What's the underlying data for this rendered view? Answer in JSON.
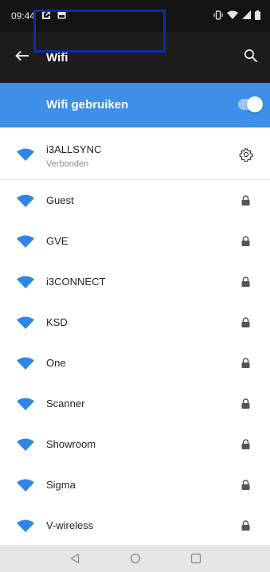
{
  "status_bar": {
    "time": "09:44",
    "left_icons": [
      "screen-record-icon",
      "gallery-icon"
    ],
    "right_icons": [
      "vibrate-icon",
      "wifi-signal-icon",
      "cell-signal-icon",
      "battery-icon"
    ]
  },
  "app_bar": {
    "title": "Wifi",
    "back_icon": "arrow-left-icon",
    "search_icon": "search-icon"
  },
  "toggle": {
    "label": "Wifi gebruiken",
    "state": "on"
  },
  "networks": [
    {
      "ssid": "i3ALLSYNC",
      "status": "Verbonden",
      "connected": true
    },
    {
      "ssid": "Guest",
      "secured": true
    },
    {
      "ssid": "GVE",
      "secured": true
    },
    {
      "ssid": "i3CONNECT",
      "secured": true
    },
    {
      "ssid": "KSD",
      "secured": true
    },
    {
      "ssid": "One",
      "secured": true
    },
    {
      "ssid": "Scanner",
      "secured": true
    },
    {
      "ssid": "Showroom",
      "secured": true
    },
    {
      "ssid": "Sigma",
      "secured": true
    },
    {
      "ssid": "V-wireless",
      "secured": true
    }
  ],
  "nav_bar": {
    "buttons": [
      "back-triangle-icon",
      "home-circle-icon",
      "recents-square-icon"
    ]
  },
  "colors": {
    "accent": "#3d8fe8",
    "highlight_border": "#0f2ab0",
    "app_bar": "#1d1d1d",
    "status_bar": "#141414"
  }
}
